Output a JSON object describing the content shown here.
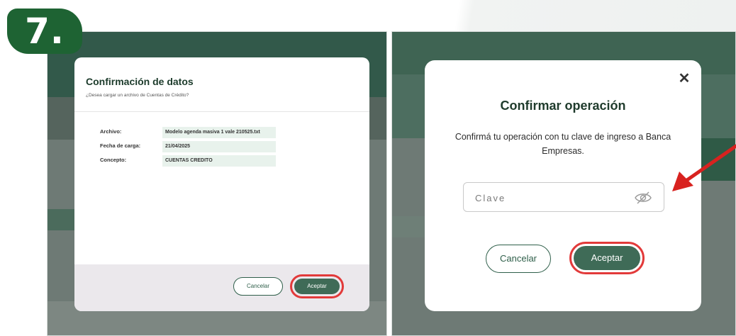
{
  "step_badge": "7.",
  "left_modal": {
    "title": "Confirmación de datos",
    "subtitle": "¿Desea cargar un archivo de Cuentas de Crédito?",
    "rows": [
      {
        "label": "Archivo:",
        "value": "Modelo agenda masiva 1 vale 210525.txt"
      },
      {
        "label": "Fecha de carga:",
        "value": "21/04/2025"
      },
      {
        "label": "Concepto:",
        "value": "CUENTAS CREDITO"
      }
    ],
    "cancel_label": "Cancelar",
    "accept_label": "Aceptar"
  },
  "right_modal": {
    "close_label": "✕",
    "title": "Confirmar operación",
    "description": "Confirmá tu operación con tu clave de ingreso a Banca Empresas.",
    "password_placeholder": "Clave",
    "password_toggle_icon": "eye-off-icon",
    "cancel_label": "Cancelar",
    "accept_label": "Aceptar"
  },
  "colors": {
    "brand_green": "#1e6333",
    "button_green": "#3f6b57",
    "highlight_red": "#e23a3a"
  }
}
